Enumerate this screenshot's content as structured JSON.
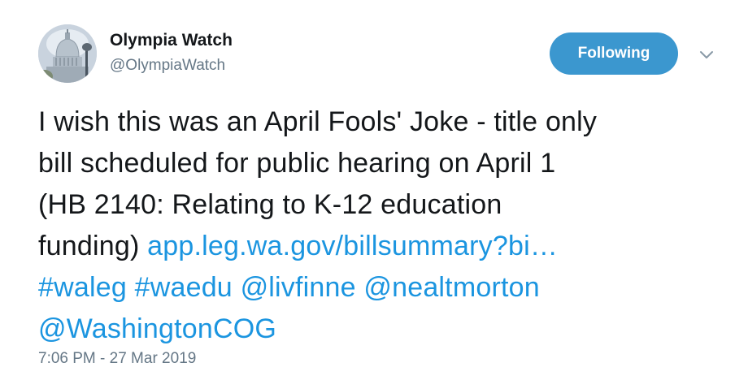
{
  "author": {
    "display_name": "Olympia Watch",
    "handle": "@OlympiaWatch"
  },
  "follow_button": {
    "label": "Following"
  },
  "tweet": {
    "text_line1": "I wish this was an April Fools' Joke - title only",
    "text_line2": "bill scheduled for public hearing on April 1",
    "text_line3": "(HB 2140: Relating to K-12 education",
    "text_line4_prefix": "funding)",
    "link": "app.leg.wa.gov/billsummary?bi…",
    "hashtags": [
      "#waleg",
      "#waedu"
    ],
    "mentions": [
      "@livfinne",
      "@nealtmorton",
      "@WashingtonCOG"
    ]
  },
  "timestamp": "7:06 PM - 27 Mar 2019",
  "icons": {
    "avatar": "capitol-dome-photo",
    "caret": "chevron-down-icon"
  },
  "colors": {
    "follow_button_bg": "#3b97cf",
    "link": "#1b95e0",
    "secondary_text": "#657786",
    "primary_text": "#14171a"
  }
}
